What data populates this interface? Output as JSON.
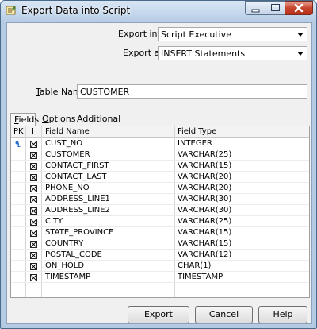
{
  "window": {
    "title": "Export Data into Script"
  },
  "form": {
    "export_into": {
      "label": "Export into",
      "value": "Script Executive"
    },
    "export_as": {
      "label": "Export as",
      "value": "INSERT Statements"
    },
    "table_name": {
      "label_prefix": "T",
      "label_rest": "able Name",
      "value": "CUSTOMER"
    }
  },
  "tabs": [
    {
      "label_u": "F",
      "label_rest": "ields",
      "active": true
    },
    {
      "label_u": "O",
      "label_rest": "ptions",
      "active": false
    },
    {
      "label": "Additional",
      "active": false
    }
  ],
  "grid": {
    "headers": {
      "pk": "PK",
      "include": "I",
      "field_name": "Field Name",
      "field_type": "Field Type"
    },
    "rows": [
      {
        "name": "CUST_NO",
        "type": "INTEGER",
        "pk": true,
        "included": true
      },
      {
        "name": "CUSTOMER",
        "type": "VARCHAR(25)",
        "pk": false,
        "included": true
      },
      {
        "name": "CONTACT_FIRST",
        "type": "VARCHAR(15)",
        "pk": false,
        "included": true
      },
      {
        "name": "CONTACT_LAST",
        "type": "VARCHAR(20)",
        "pk": false,
        "included": true
      },
      {
        "name": "PHONE_NO",
        "type": "VARCHAR(20)",
        "pk": false,
        "included": true
      },
      {
        "name": "ADDRESS_LINE1",
        "type": "VARCHAR(30)",
        "pk": false,
        "included": true
      },
      {
        "name": "ADDRESS_LINE2",
        "type": "VARCHAR(30)",
        "pk": false,
        "included": true
      },
      {
        "name": "CITY",
        "type": "VARCHAR(25)",
        "pk": false,
        "included": true
      },
      {
        "name": "STATE_PROVINCE",
        "type": "VARCHAR(15)",
        "pk": false,
        "included": true
      },
      {
        "name": "COUNTRY",
        "type": "VARCHAR(15)",
        "pk": false,
        "included": true
      },
      {
        "name": "POSTAL_CODE",
        "type": "VARCHAR(12)",
        "pk": false,
        "included": true
      },
      {
        "name": "ON_HOLD",
        "type": "CHAR(1)",
        "pk": false,
        "included": true
      },
      {
        "name": "TIMESTAMP",
        "type": "TIMESTAMP",
        "pk": false,
        "included": true
      }
    ]
  },
  "buttons": {
    "export": "Export",
    "cancel": "Cancel",
    "help": "Help"
  },
  "colors": {
    "title_bar": "#b9cfe6",
    "close_button": "#c7452e",
    "dialog_bg": "#f0f0f0",
    "pk_key": "#2a6fd0"
  }
}
